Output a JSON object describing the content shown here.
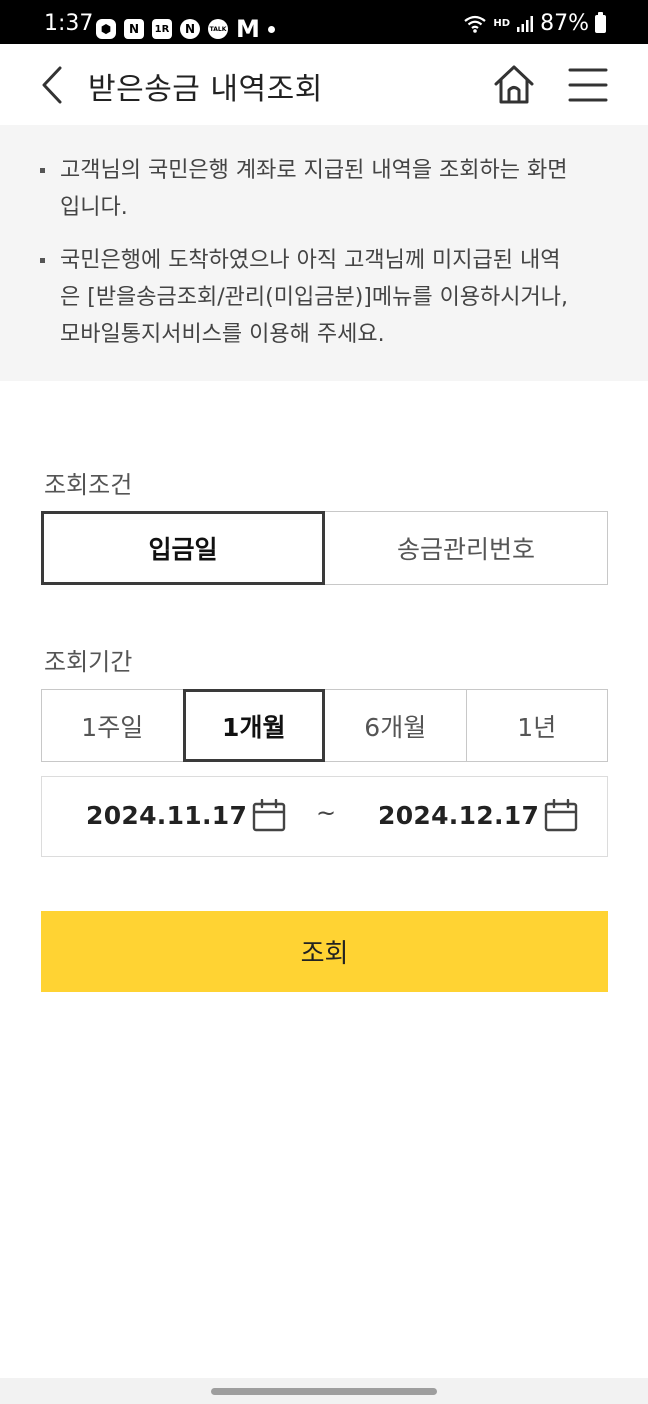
{
  "status_bar": {
    "time": "1:37",
    "battery": "87%",
    "hd_label": "HD",
    "app_icons": [
      {
        "name": "box-icon",
        "glyph": "⬢"
      },
      {
        "name": "naver-icon",
        "glyph": "N"
      },
      {
        "name": "onestore-icon",
        "glyph": "1R"
      },
      {
        "name": "naver-circle-icon",
        "glyph": "N"
      },
      {
        "name": "kakaotalk-icon",
        "glyph": "TALK"
      }
    ],
    "m_icon": "M"
  },
  "header": {
    "title": "받은송금 내역조회"
  },
  "notice": {
    "items": [
      "고객님의 국민은행 계좌로 지급된 내역을 조회하는 화면입니다.",
      "국민은행에 도착하였으나 아직 고객님께 미지급된 내역은 [받을송금조회/관리(미입금분)]메뉴를 이용하시거나, 모바일통지서비스를 이용해 주세요."
    ]
  },
  "condition": {
    "label": "조회조건",
    "options": [
      "입금일",
      "송금관리번호"
    ],
    "selected": "입금일"
  },
  "period": {
    "label": "조회기간",
    "options": [
      "1주일",
      "1개월",
      "6개월",
      "1년"
    ],
    "selected": "1개월",
    "start_date": "2024.11.17",
    "end_date": "2024.12.17",
    "separator": "~"
  },
  "search_button": {
    "label": "조회"
  },
  "colors": {
    "accent": "#ffd333",
    "notice_bg": "#f5f5f5",
    "status_bar_bg": "#000000"
  }
}
